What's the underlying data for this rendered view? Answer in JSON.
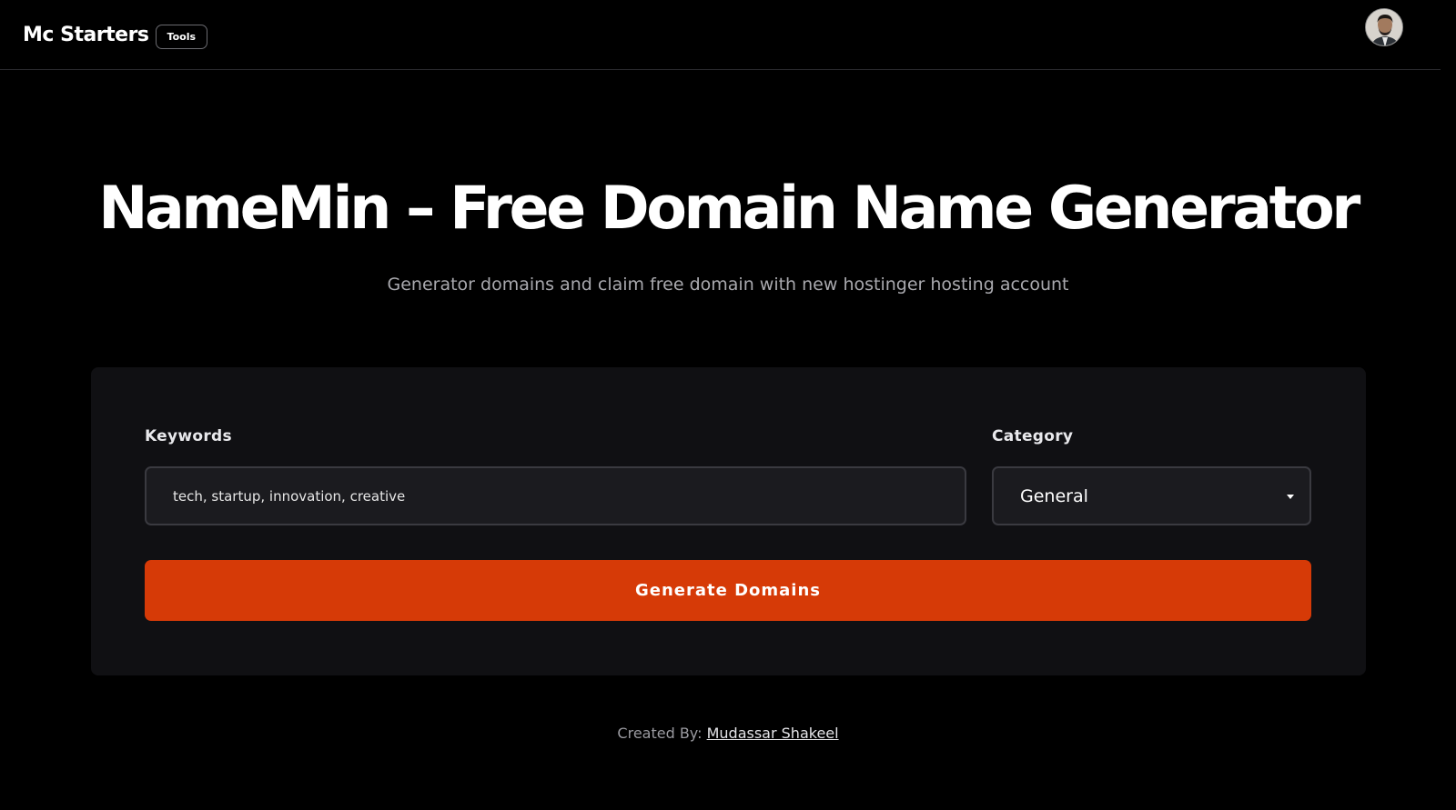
{
  "header": {
    "brand": "Mc Starters",
    "badge": "Tools",
    "avatar_alt": "user-avatar"
  },
  "hero": {
    "title": "NameMin – Free Domain Name Generator",
    "subtitle": "Generator domains and claim free domain with new hostinger hosting account"
  },
  "form": {
    "keywords_label": "Keywords",
    "keywords_placeholder": "tech, startup, innovation, creative",
    "keywords_value": "",
    "category_label": "Category",
    "category_value": "General",
    "generate_label": "Generate Domains"
  },
  "footer": {
    "prefix": "Created By:",
    "author": "Mudassar Shakeel"
  },
  "colors": {
    "background": "#000000",
    "card": "#101013",
    "accent": "#d63a07",
    "input_bg": "#1b1b1f"
  }
}
